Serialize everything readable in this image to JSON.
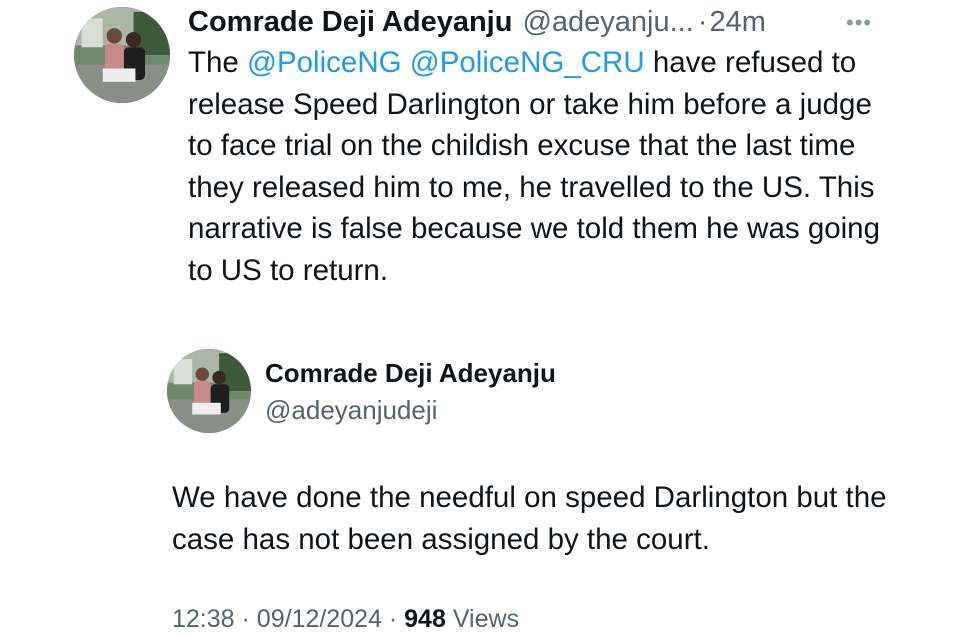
{
  "tweet": {
    "author_name": "Comrade Deji Adeyanju",
    "author_handle": "@adeyanju...",
    "separator": "·",
    "time_ago": "24m",
    "more_icon": "more-horizontal-icon",
    "text_parts": {
      "intro": "The ",
      "mention_1": "@PoliceNG",
      "space": " ",
      "mention_2": "@PoliceNG_CRU",
      "body": " have refused to release Speed Darlington or take him before a judge to face trial on the childish excuse that the last time they released him to me, he travelled to the US. This narrative is false because we told them he was going to US to return."
    }
  },
  "quoted_tweet": {
    "author_name": "Comrade Deji Adeyanju",
    "author_handle": "@adeyanjudeji",
    "text": "We have done the needful on speed Darlington but the case has not been assigned by the court."
  },
  "meta": {
    "time": "12:38",
    "separator_1": "·",
    "date": "09/12/2024",
    "separator_2": "·",
    "views_count": "948",
    "views_label": "Views"
  },
  "colors": {
    "link": "#1d9bf0",
    "secondary_text": "#536471",
    "primary_text": "#0f1419"
  }
}
